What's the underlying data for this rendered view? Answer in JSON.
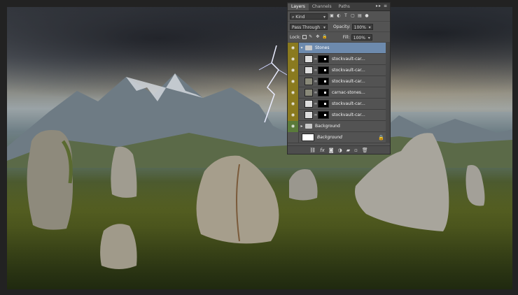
{
  "panel": {
    "tabs": [
      "Layers",
      "Channels",
      "Paths"
    ],
    "tab_menu_icons": "▸▸ ≡",
    "kind_filter": "Kind",
    "blend_mode": "Pass Through",
    "opacity_label": "Opacity:",
    "opacity_value": "100%",
    "lock_label": "Lock:",
    "fill_label": "Fill:",
    "fill_value": "100%",
    "group_name": "Stones",
    "layers": [
      {
        "name": "stockvault-car..."
      },
      {
        "name": "stockvault-car..."
      },
      {
        "name": "stockvault-car..."
      },
      {
        "name": "carnac-stones..."
      },
      {
        "name": "stockvault-car..."
      },
      {
        "name": "stockvault-car..."
      }
    ],
    "background_group": "Background",
    "background_layer": "Background",
    "footer_icons": [
      "link-icon",
      "fx-icon",
      "mask-icon",
      "adjustment-icon",
      "folder-icon",
      "new-layer-icon",
      "trash-icon"
    ]
  },
  "colors": {
    "panel_bg": "#535353",
    "group_highlight": "#6d8aad",
    "visibility_olive": "#8a7a1f"
  }
}
